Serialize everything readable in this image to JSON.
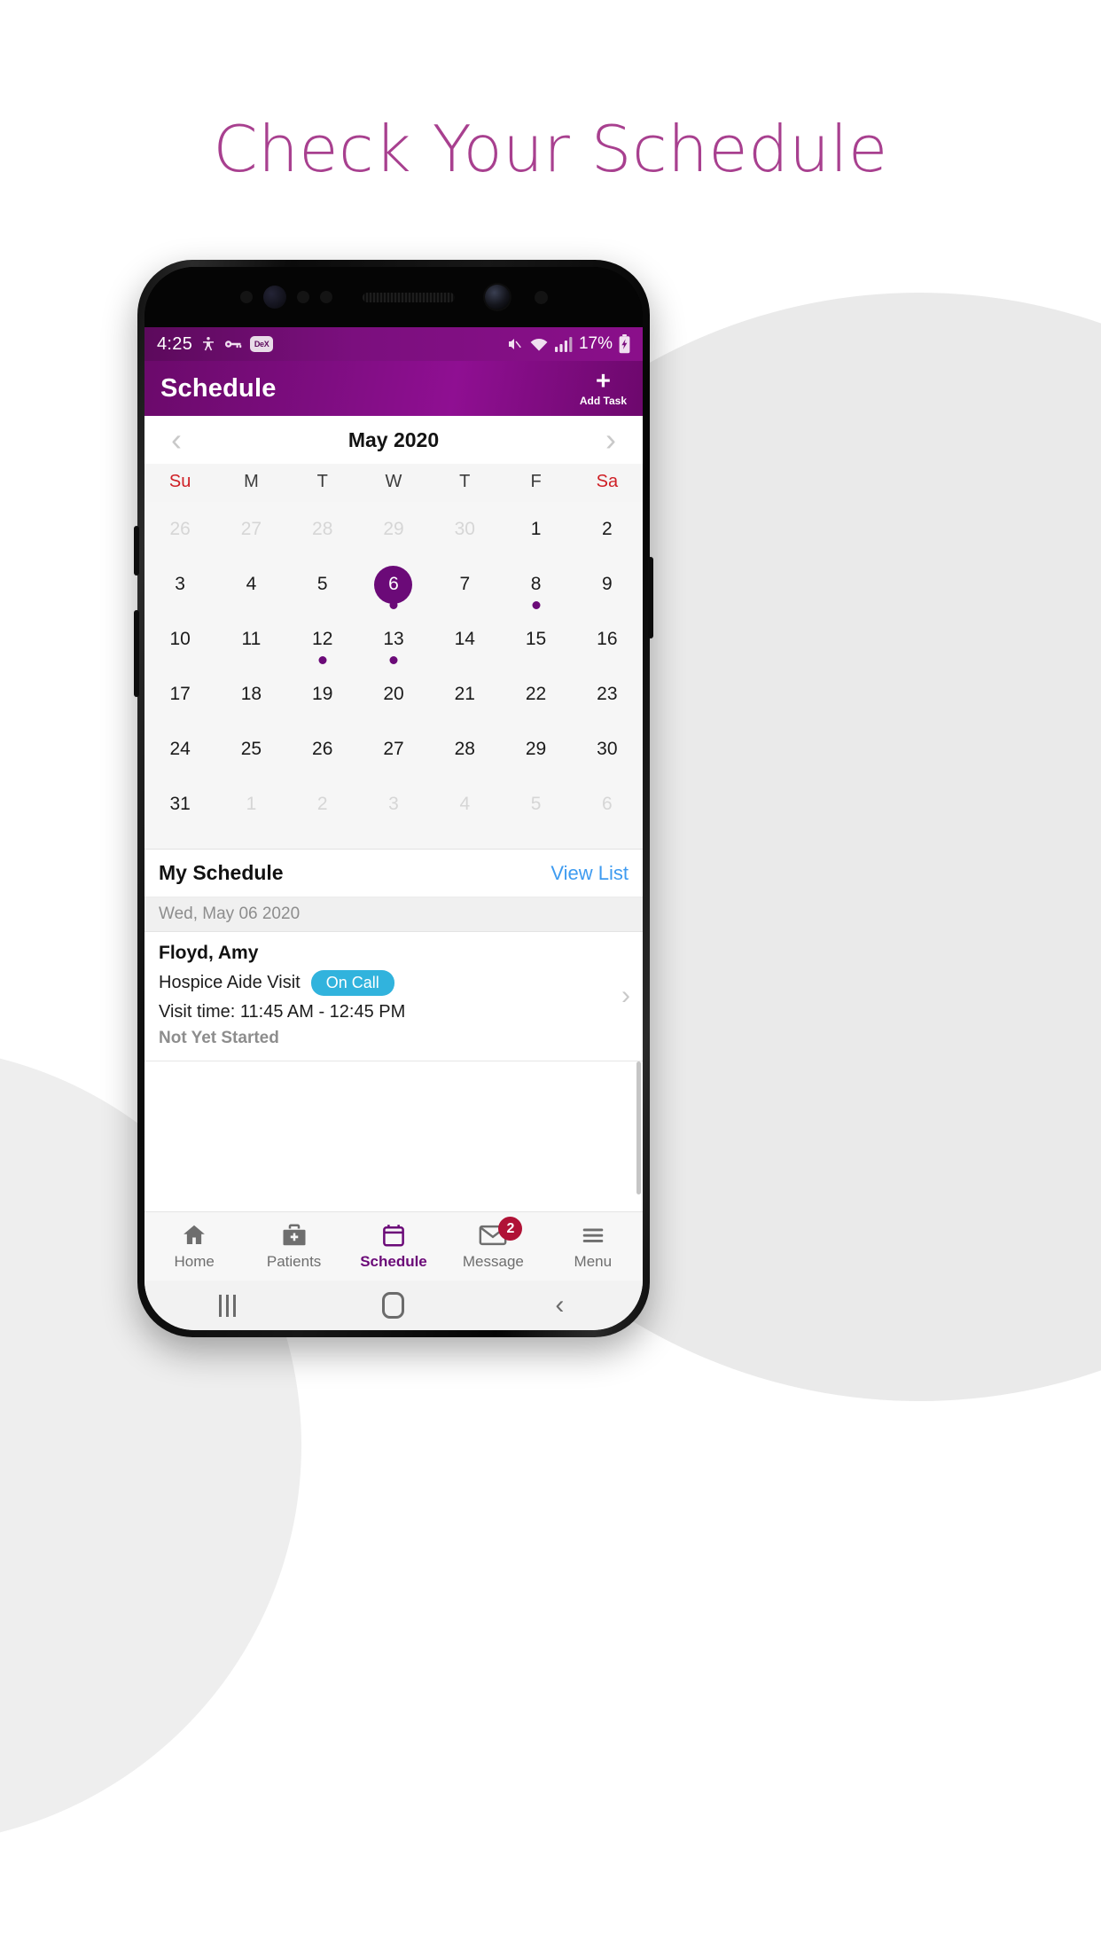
{
  "headline": "Check Your Schedule",
  "theme": {
    "brand_purple": "#6b0a78",
    "accent_blue": "#3e9bf0",
    "pill_cyan": "#31b3dd",
    "badge_red": "#b01236",
    "headline_purple": "#a8408f",
    "weekend_red": "#cf2026"
  },
  "status_bar": {
    "time": "4:25",
    "icons_left": [
      "accessibility-icon",
      "key-icon"
    ],
    "dex_label": "DeX",
    "icons_right": [
      "mute-icon",
      "wifi-icon",
      "signal-icon"
    ],
    "battery_percent": "17%",
    "battery_state": "charging"
  },
  "app_bar": {
    "title": "Schedule",
    "add_task": {
      "plus": "+",
      "label": "Add Task"
    }
  },
  "calendar": {
    "prev_label": "‹",
    "next_label": "›",
    "month_label": "May 2020",
    "day_headers": [
      {
        "label": "Su",
        "weekend": true
      },
      {
        "label": "M",
        "weekend": false
      },
      {
        "label": "T",
        "weekend": false
      },
      {
        "label": "W",
        "weekend": false
      },
      {
        "label": "T",
        "weekend": false
      },
      {
        "label": "F",
        "weekend": false
      },
      {
        "label": "Sa",
        "weekend": true
      }
    ],
    "cells": [
      {
        "d": "26",
        "muted": true
      },
      {
        "d": "27",
        "muted": true
      },
      {
        "d": "28",
        "muted": true
      },
      {
        "d": "29",
        "muted": true
      },
      {
        "d": "30",
        "muted": true
      },
      {
        "d": "1",
        "muted": false
      },
      {
        "d": "2",
        "muted": false
      },
      {
        "d": "3",
        "muted": false
      },
      {
        "d": "4",
        "muted": false
      },
      {
        "d": "5",
        "muted": false
      },
      {
        "d": "6",
        "muted": false,
        "selected": true,
        "dot": true
      },
      {
        "d": "7",
        "muted": false
      },
      {
        "d": "8",
        "muted": false,
        "dot": true
      },
      {
        "d": "9",
        "muted": false
      },
      {
        "d": "10",
        "muted": false
      },
      {
        "d": "11",
        "muted": false
      },
      {
        "d": "12",
        "muted": false,
        "dot": true
      },
      {
        "d": "13",
        "muted": false,
        "dot": true
      },
      {
        "d": "14",
        "muted": false
      },
      {
        "d": "15",
        "muted": false
      },
      {
        "d": "16",
        "muted": false
      },
      {
        "d": "17",
        "muted": false
      },
      {
        "d": "18",
        "muted": false
      },
      {
        "d": "19",
        "muted": false
      },
      {
        "d": "20",
        "muted": false
      },
      {
        "d": "21",
        "muted": false
      },
      {
        "d": "22",
        "muted": false
      },
      {
        "d": "23",
        "muted": false
      },
      {
        "d": "24",
        "muted": false
      },
      {
        "d": "25",
        "muted": false
      },
      {
        "d": "26",
        "muted": false
      },
      {
        "d": "27",
        "muted": false
      },
      {
        "d": "28",
        "muted": false
      },
      {
        "d": "29",
        "muted": false
      },
      {
        "d": "30",
        "muted": false
      },
      {
        "d": "31",
        "muted": false
      },
      {
        "d": "1",
        "muted": true
      },
      {
        "d": "2",
        "muted": true
      },
      {
        "d": "3",
        "muted": true
      },
      {
        "d": "4",
        "muted": true
      },
      {
        "d": "5",
        "muted": true
      },
      {
        "d": "6",
        "muted": true
      }
    ]
  },
  "schedule": {
    "section_title": "My Schedule",
    "view_list_label": "View List",
    "day_header": "Wed, May 06 2020",
    "appointments": [
      {
        "patient": "Floyd, Amy",
        "visit_type": "Hospice Aide Visit",
        "tag": "On Call",
        "time": "Visit time: 11:45 AM - 12:45 PM",
        "status": "Not Yet Started"
      }
    ]
  },
  "bottom_nav": [
    {
      "label": "Home",
      "icon": "home-icon",
      "active": false
    },
    {
      "label": "Patients",
      "icon": "medical-bag-icon",
      "active": false
    },
    {
      "label": "Schedule",
      "icon": "calendar-icon",
      "active": true
    },
    {
      "label": "Message",
      "icon": "envelope-icon",
      "active": false,
      "badge": "2"
    },
    {
      "label": "Menu",
      "icon": "hamburger-icon",
      "active": false
    }
  ],
  "android_nav": {
    "recents": "recents-icon",
    "home": "home-pill-icon",
    "back": "‹"
  }
}
